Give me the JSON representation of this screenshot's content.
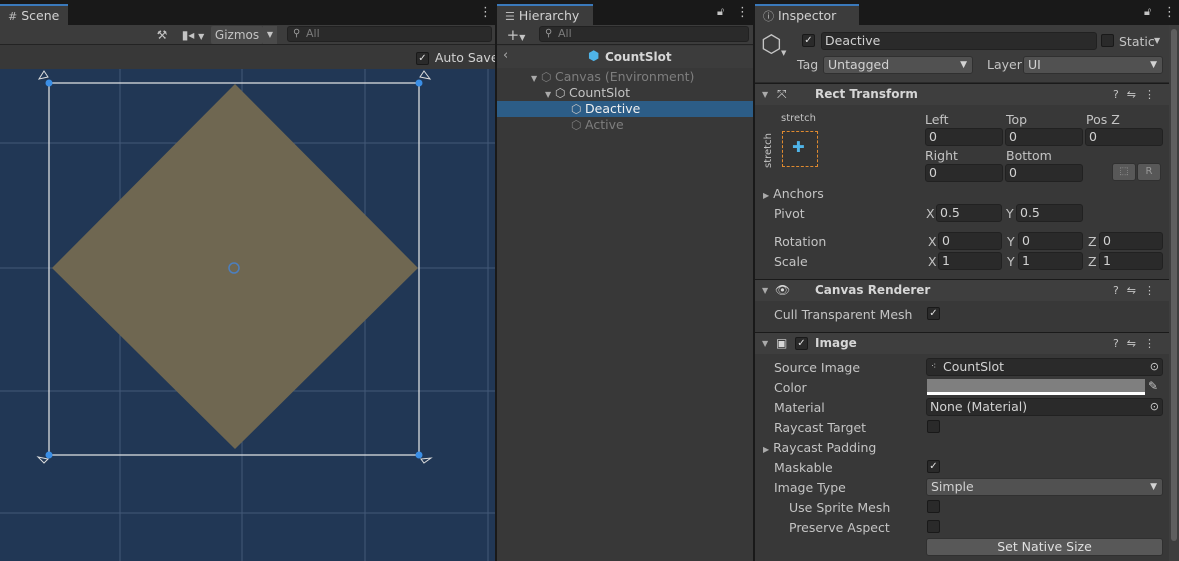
{
  "scene": {
    "tab": "Scene",
    "gizmos": "Gizmos",
    "search_placeholder": "All",
    "auto_save": "Auto Save"
  },
  "hierarchy": {
    "tab": "Hierarchy",
    "search_placeholder": "All",
    "prefab_title": "CountSlot",
    "items": [
      {
        "label": "Canvas (Environment)"
      },
      {
        "label": "CountSlot"
      },
      {
        "label": "Deactive"
      },
      {
        "label": "Active"
      }
    ]
  },
  "inspector": {
    "tab": "Inspector",
    "object_name": "Deactive",
    "static_label": "Static",
    "tag_label": "Tag",
    "tag_value": "Untagged",
    "layer_label": "Layer",
    "layer_value": "UI",
    "rect_transform": {
      "title": "Rect Transform",
      "anchor_h": "stretch",
      "anchor_v": "stretch",
      "left_label": "Left",
      "left": "0",
      "top_label": "Top",
      "top": "0",
      "posz_label": "Pos Z",
      "posz": "0",
      "right_label": "Right",
      "right": "0",
      "bottom_label": "Bottom",
      "bottom": "0",
      "r_button": "R",
      "anchors_label": "Anchors",
      "pivot_label": "Pivot",
      "pivot_x": "0.5",
      "pivot_y": "0.5",
      "rotation_label": "Rotation",
      "rot_x": "0",
      "rot_y": "0",
      "rot_z": "0",
      "scale_label": "Scale",
      "scale_x": "1",
      "scale_y": "1",
      "scale_z": "1",
      "x": "X",
      "y": "Y",
      "z": "Z"
    },
    "canvas_renderer": {
      "title": "Canvas Renderer",
      "cull_label": "Cull Transparent Mesh"
    },
    "image": {
      "title": "Image",
      "source_image_label": "Source Image",
      "source_image": "CountSlot",
      "color_label": "Color",
      "material_label": "Material",
      "material": "None (Material)",
      "raycast_target_label": "Raycast Target",
      "raycast_padding_label": "Raycast Padding",
      "maskable_label": "Maskable",
      "image_type_label": "Image Type",
      "image_type": "Simple",
      "use_sprite_mesh_label": "Use Sprite Mesh",
      "preserve_aspect_label": "Preserve Aspect",
      "set_native_size": "Set Native Size"
    }
  },
  "colors": {
    "scene_bg": "#213755",
    "diamond": "#6f6751",
    "selection": "#2c5d87",
    "accent": "#3a79bb"
  }
}
